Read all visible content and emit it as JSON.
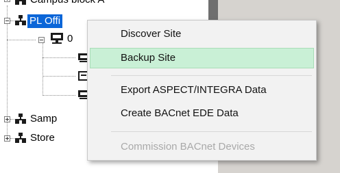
{
  "tree": {
    "items": [
      {
        "label": "Campus block A"
      },
      {
        "label": "PL Offi"
      },
      {
        "label": "0"
      },
      {
        "label": ""
      },
      {
        "label": ""
      },
      {
        "label": ""
      },
      {
        "label": "Samp"
      },
      {
        "label": "Store"
      }
    ]
  },
  "context_menu": {
    "items": [
      {
        "label": "Discover Site",
        "enabled": true
      },
      {
        "label": "Backup Site",
        "enabled": true,
        "highlighted": true
      },
      {
        "label": "Export ASPECT/INTEGRA Data",
        "enabled": true
      },
      {
        "label": "Create BACnet EDE Data",
        "enabled": true
      },
      {
        "label": "Commission BACnet Devices",
        "enabled": false
      }
    ]
  },
  "colors": {
    "selection": "#0b66d8",
    "menu_highlight": "#c9f0d6",
    "right_panel": "#d6d3cf"
  },
  "icons": [
    "collapse-icon",
    "expand-icon",
    "site-icon",
    "monitor-icon",
    "device-box-icon"
  ]
}
